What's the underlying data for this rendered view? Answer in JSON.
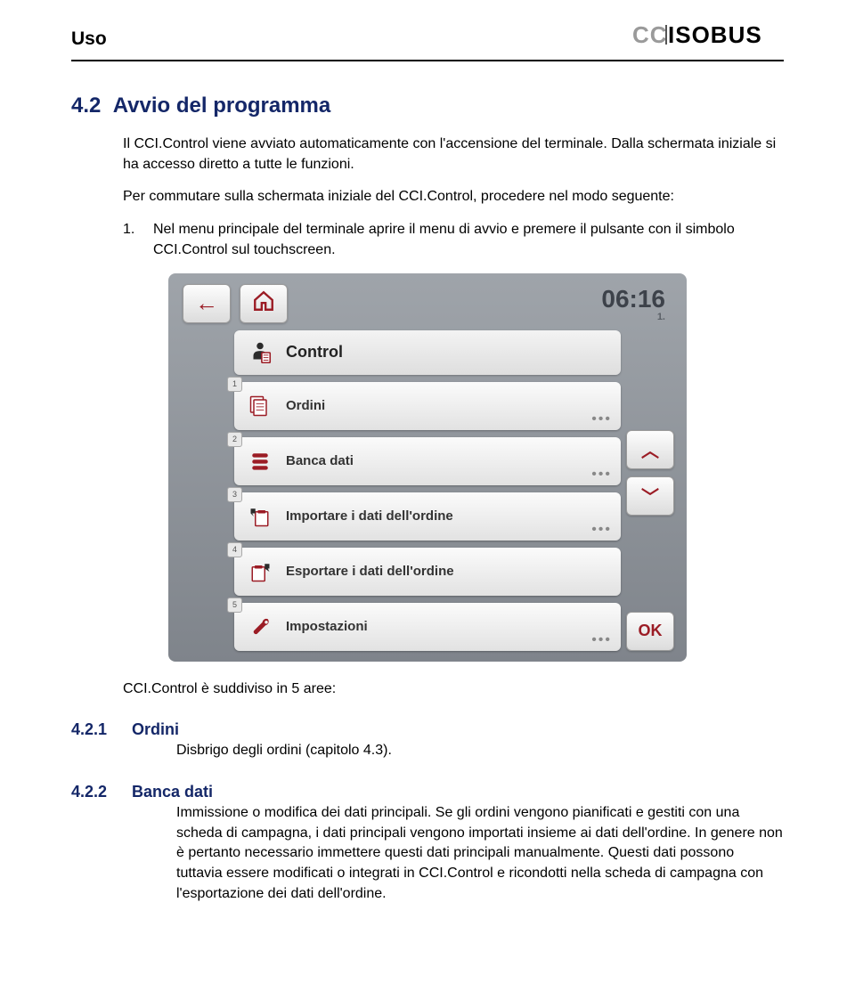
{
  "header": {
    "title": "Uso",
    "logo": "CCISOBUS"
  },
  "section": {
    "number": "4.2",
    "title": "Avvio del programma"
  },
  "para1": "Il CCI.Control viene avviato automaticamente con l'accensione del terminale. Dalla schermata iniziale si ha accesso diretto a tutte le funzioni.",
  "para2": "Per commutare sulla schermata iniziale del CCI.Control, procedere nel modo seguente:",
  "step1_num": "1.",
  "step1_txt": "Nel menu principale del terminale aprire il menu di avvio e premere il pulsante con il simbolo CCI.Control sul touchscreen.",
  "screenshot": {
    "time": "06:16",
    "time_sub": "1.",
    "group": "Control",
    "items": [
      {
        "n": "1",
        "label": "Ordini",
        "icon": "ordini"
      },
      {
        "n": "2",
        "label": "Banca dati",
        "icon": "banca"
      },
      {
        "n": "3",
        "label": "Importare i dati dell'ordine",
        "icon": "import"
      },
      {
        "n": "4",
        "label": "Esportare i dati dell'ordine",
        "icon": "export"
      },
      {
        "n": "5",
        "label": "Impostazioni",
        "icon": "settings"
      }
    ],
    "ok": "OK"
  },
  "para3": "CCI.Control è suddiviso in 5 aree:",
  "sub1": {
    "num": "4.2.1",
    "title": "Ordini",
    "text": "Disbrigo degli ordini (capitolo 4.3)."
  },
  "sub2": {
    "num": "4.2.2",
    "title": "Banca dati",
    "text": "Immissione o modifica dei dati principali. Se gli ordini vengono pianificati e gestiti con una scheda di campagna, i dati principali vengono importati insieme ai dati dell'ordine. In genere non è pertanto necessario immettere questi dati principali manualmente. Questi dati possono tuttavia essere modificati o integrati in CCI.Control e ricondotti nella scheda di campagna con l'esportazione dei dati dell'ordine."
  }
}
